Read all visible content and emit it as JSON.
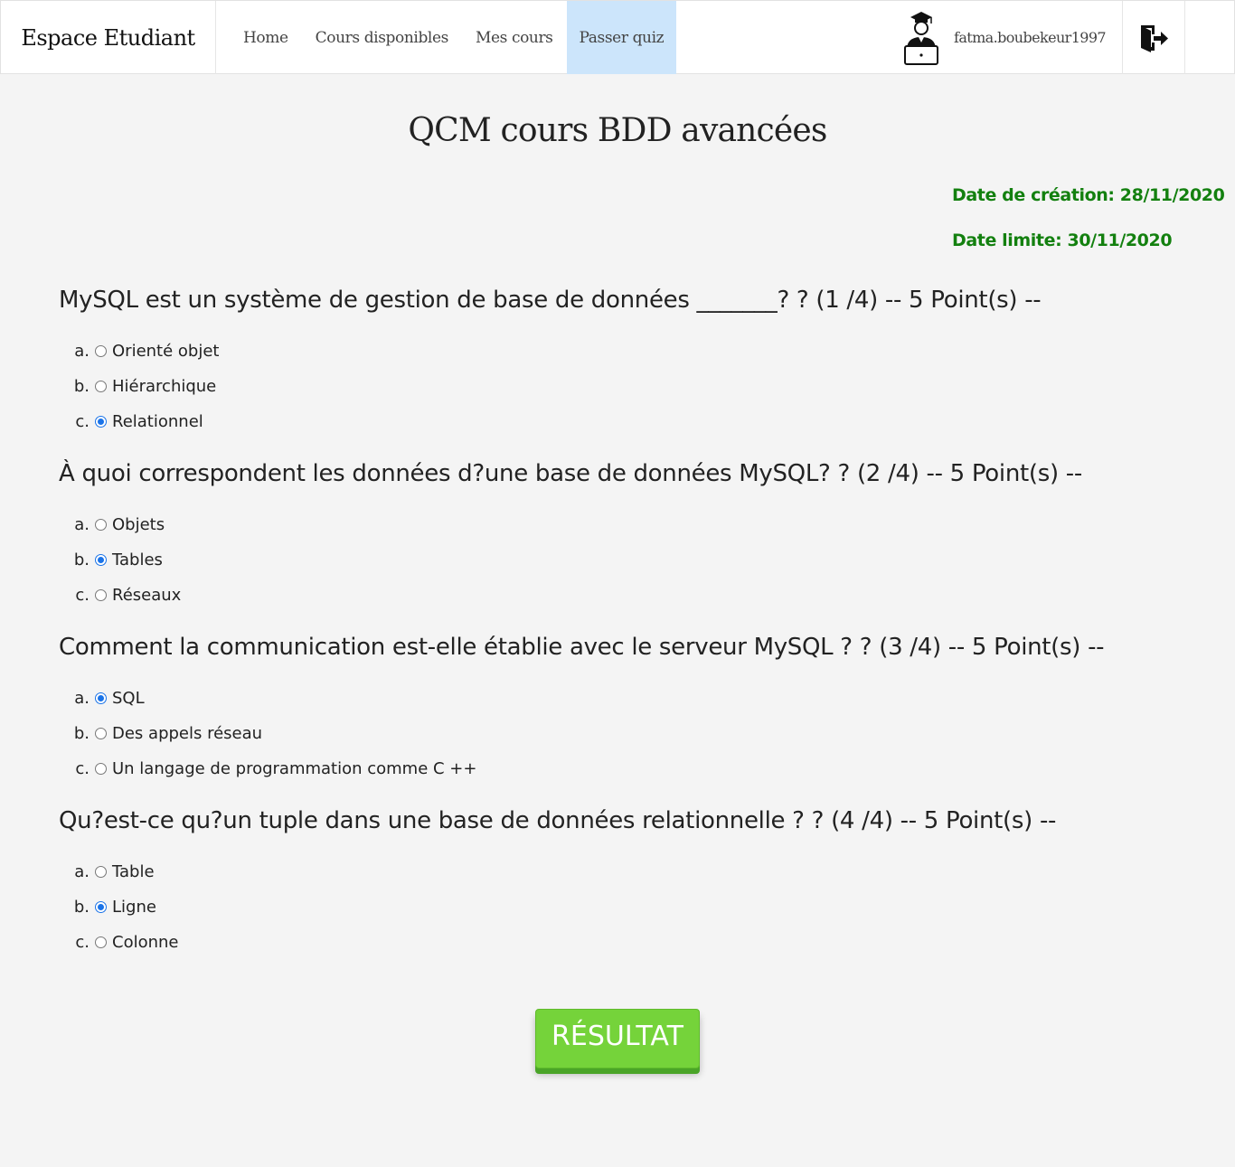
{
  "navbar": {
    "brand": "Espace Etudiant",
    "links": [
      {
        "label": "Home"
      },
      {
        "label": "Cours disponibles"
      },
      {
        "label": "Mes cours"
      },
      {
        "label": "Passer quiz",
        "active": true
      }
    ],
    "username": "fatma.boubekeur1997",
    "avatar_icon": "student-graduate-icon",
    "logout_icon": "logout-door-icon",
    "active_color": "#cce5fb"
  },
  "quiz": {
    "title": "QCM cours BDD avancées",
    "date_created": "Date de création: 28/11/2020",
    "date_limit": "Date limite: 30/11/2020",
    "date_color": "#13800f",
    "questions": [
      {
        "text": "MySQL est un système de gestion de base de données _______? ? (1 /4) -- 5 Point(s) --",
        "options": [
          {
            "letter": "a.",
            "label": "Orienté objet",
            "checked": false
          },
          {
            "letter": "b.",
            "label": "Hiérarchique",
            "checked": false
          },
          {
            "letter": "c.",
            "label": "Relationnel",
            "checked": true
          }
        ]
      },
      {
        "text": "À quoi correspondent les données d?une base de données MySQL? ? (2 /4) -- 5 Point(s) --",
        "options": [
          {
            "letter": "a.",
            "label": "Objets",
            "checked": false
          },
          {
            "letter": "b.",
            "label": "Tables",
            "checked": true
          },
          {
            "letter": "c.",
            "label": "Réseaux",
            "checked": false
          }
        ]
      },
      {
        "text": "Comment la communication est-elle établie avec le serveur MySQL ? ? (3 /4) -- 5 Point(s) --",
        "options": [
          {
            "letter": "a.",
            "label": "SQL",
            "checked": true
          },
          {
            "letter": "b.",
            "label": "Des appels réseau",
            "checked": false
          },
          {
            "letter": "c.",
            "label": "Un langage de programmation comme C ++",
            "checked": false
          }
        ]
      },
      {
        "text": "Qu?est-ce qu?un tuple dans une base de données relationnelle ? ? (4 /4) -- 5 Point(s) --",
        "options": [
          {
            "letter": "a.",
            "label": "Table",
            "checked": false
          },
          {
            "letter": "b.",
            "label": "Ligne",
            "checked": true
          },
          {
            "letter": "c.",
            "label": "Colonne",
            "checked": false
          }
        ]
      }
    ],
    "submit_label": "RÉSULTAT",
    "submit_color": "#75d33a"
  }
}
